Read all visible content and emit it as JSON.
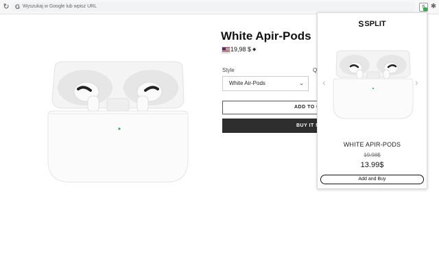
{
  "browser": {
    "omnibox_placeholder": "Wyszukaj w Google lub wpisz URL",
    "extension_icon_glyph": "S",
    "reload_glyph": "↻",
    "google_glyph": "G",
    "puzzle_glyph": "✱"
  },
  "product": {
    "title": "White Apir-Pods",
    "price": "19,98 $",
    "currency_toggle_glyph": "◆",
    "style_label": "Style",
    "qty_label": "Q",
    "style_value": "White Air-Pods",
    "add_to_cart_label": "ADD TO C",
    "buy_now_label": "BUY IT N"
  },
  "popup": {
    "brand": "SPLIT",
    "brand_mark": "S",
    "product_name": "WHITE APIR-PODS",
    "old_price": "19.98$",
    "new_price": "13.99$",
    "button_label": "Add and Buy",
    "arrow_left": "‹",
    "arrow_right": "›"
  },
  "colors": {
    "buy_button_bg": "#2e2e2e",
    "badge_green": "#2db14a"
  }
}
